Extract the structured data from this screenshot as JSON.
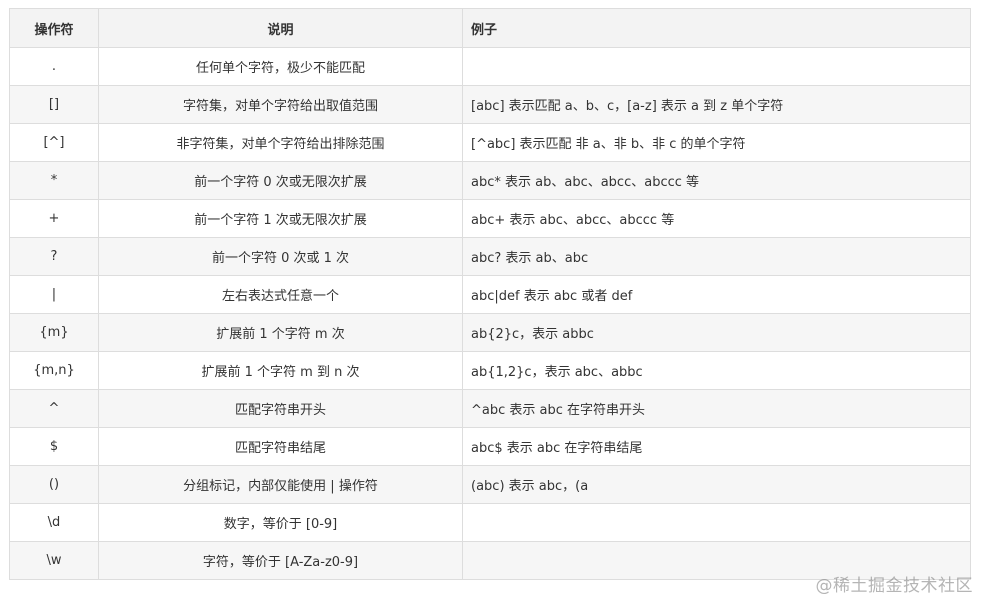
{
  "table": {
    "headers": {
      "operator": "操作符",
      "description": "说明",
      "example": "例子"
    },
    "rows": [
      {
        "operator": ".",
        "description": "任何单个字符，极少不能匹配",
        "example": ""
      },
      {
        "operator": "[]",
        "description": "字符集，对单个字符给出取值范围",
        "example": "[abc] 表示匹配 a、b、c，[a-z] 表示 a 到 z 单个字符"
      },
      {
        "operator": "[^]",
        "description": "非字符集，对单个字符给出排除范围",
        "example": "[^abc] 表示匹配 非 a、非 b、非 c 的单个字符"
      },
      {
        "operator": "*",
        "description": "前一个字符 0 次或无限次扩展",
        "example": "abc* 表示 ab、abc、abcc、abccc 等"
      },
      {
        "operator": "+",
        "description": "前一个字符 1 次或无限次扩展",
        "example": "abc+ 表示 abc、abcc、abccc 等"
      },
      {
        "operator": "?",
        "description": "前一个字符 0 次或 1 次",
        "example": "abc? 表示 ab、abc"
      },
      {
        "operator": "|",
        "description": "左右表达式任意一个",
        "example": "abc|def 表示 abc 或者 def"
      },
      {
        "operator": "{m}",
        "description": "扩展前 1 个字符 m 次",
        "example": "ab{2}c，表示 abbc"
      },
      {
        "operator": "{m,n}",
        "description": "扩展前 1 个字符 m 到 n 次",
        "example": "ab{1,2}c，表示 abc、abbc"
      },
      {
        "operator": "^",
        "description": "匹配字符串开头",
        "example": "^abc 表示 abc 在字符串开头"
      },
      {
        "operator": "$",
        "description": "匹配字符串结尾",
        "example": "abc$ 表示 abc 在字符串结尾"
      },
      {
        "operator": "()",
        "description": "分组标记，内部仅能使用 | 操作符",
        "example": "(abc) 表示 abc，(a"
      },
      {
        "operator": "\\d",
        "description": "数字，等价于 [0-9]",
        "example": ""
      },
      {
        "operator": "\\w",
        "description": "字符，等价于 [A-Za-z0-9]",
        "example": ""
      }
    ]
  },
  "watermark": "@稀土掘金技术社区"
}
